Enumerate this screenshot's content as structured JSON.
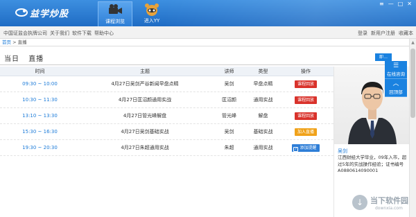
{
  "app": {
    "name": "益学炒股"
  },
  "nav": {
    "tabs": [
      {
        "label": "课程浏览",
        "active": true
      },
      {
        "label": "进入YY",
        "active": false
      }
    ]
  },
  "window_controls": {
    "menu": "≡",
    "minimize": "—",
    "maximize": "□",
    "close": "✕"
  },
  "topbar": {
    "links": [
      "中国证监会执牌公司",
      "关于我们",
      "软件下载",
      "帮助中心"
    ],
    "right": [
      "登录",
      "新用户注册",
      "收藏本"
    ]
  },
  "breadcrumb": {
    "home": "首页",
    "sep": " > ",
    "current": "直播"
  },
  "page_title": {
    "left": "当日",
    "right": "直播"
  },
  "more_tab": "即…",
  "table": {
    "headers": [
      "时间",
      "主题",
      "讲师",
      "类型",
      "操作"
    ],
    "rows": [
      {
        "time": "09:30 ~ 10:00",
        "topic": "4月27日吴剑严谷新闻早盘点睛",
        "teacher": "吴剑",
        "type": "早盘点睛",
        "action": "课程回放",
        "style": "red"
      },
      {
        "time": "10:30 ~ 11:30",
        "topic": "4月27日匡沼颜通用实战",
        "teacher": "匡沼颜",
        "type": "通用实战",
        "action": "课程回放",
        "style": "red"
      },
      {
        "time": "13:10 ~ 13:30",
        "topic": "4月27日管光峰解盘",
        "teacher": "管光峰",
        "type": "解盘",
        "action": "课程回放",
        "style": "red"
      },
      {
        "time": "15:30 ~ 16:30",
        "topic": "4月27日吴剑基础实战",
        "teacher": "吴剑",
        "type": "基础实战",
        "action": "加入直播",
        "style": "orange"
      },
      {
        "time": "19:30 ~ 20:30",
        "topic": "4月27日朱超通用实战",
        "teacher": "朱超",
        "type": "通用实战",
        "action": "添加提醒",
        "style": "blue"
      }
    ]
  },
  "float_panel": {
    "consult": "在线咨询",
    "top": "回顶部"
  },
  "teacher": {
    "name": "吴剑",
    "bio": "江西财经大学毕业，09年入市，超\n过5年的实战操作经验；证书编号\nA0880614090001"
  },
  "watermark": {
    "title": "当下软件园",
    "url": "downxia.com"
  },
  "colors": {
    "titlebar": "#1f6cc4",
    "link": "#1a7ad8",
    "replay": "#d9322b",
    "join": "#f0a21a",
    "remind": "#2e7ed7"
  }
}
